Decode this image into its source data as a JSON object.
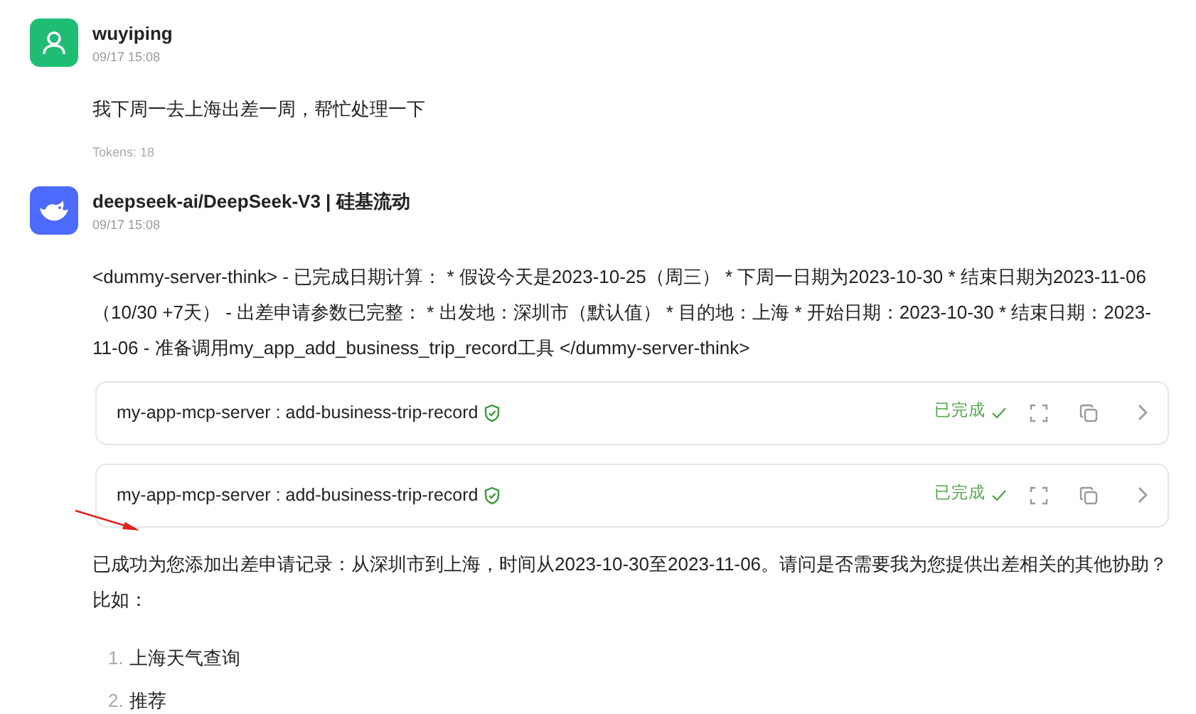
{
  "messages": [
    {
      "kind": "user",
      "author": "wuyiping",
      "time": "09/17 15:08",
      "paragraphs": [
        "我下周一去上海出差一周，帮忙处理一下"
      ],
      "tokens": "Tokens: 18"
    },
    {
      "kind": "assistant",
      "author": "deepseek-ai/DeepSeek-V3 | 硅基流动",
      "time": "09/17 15:08",
      "paragraphs": [
        "<dummy-server-think> - 已完成日期计算： * 假设今天是2023-10-25（周三） * 下周一日期为2023-10-30 * 结束日期为2023-11-06（10/30 +7天） - 出差申请参数已完整： * 出发地：深圳市（默认值） * 目的地：上海 * 开始日期：2023-10-30 * 结束日期：2023-11-06 - 准备调用my_app_add_business_trip_record工具 </dummy-server-think>"
      ],
      "tool_calls": [
        {
          "name": "my-app-mcp-server : add-business-trip-record",
          "status": "已完成",
          "completed": true
        },
        {
          "name": "my-app-mcp-server : add-business-trip-record",
          "status": "已完成",
          "completed": true
        }
      ],
      "reply": "已成功为您添加出差申请记录：从深圳市到上海，时间从2023-10-30至2023-11-06。请问是否需要我为您提供出差相关的其他协助？比如：",
      "list": [
        {
          "number": "1.",
          "text": "上海天气查询"
        },
        {
          "number": "2.",
          "text": "推荐"
        }
      ]
    }
  ]
}
